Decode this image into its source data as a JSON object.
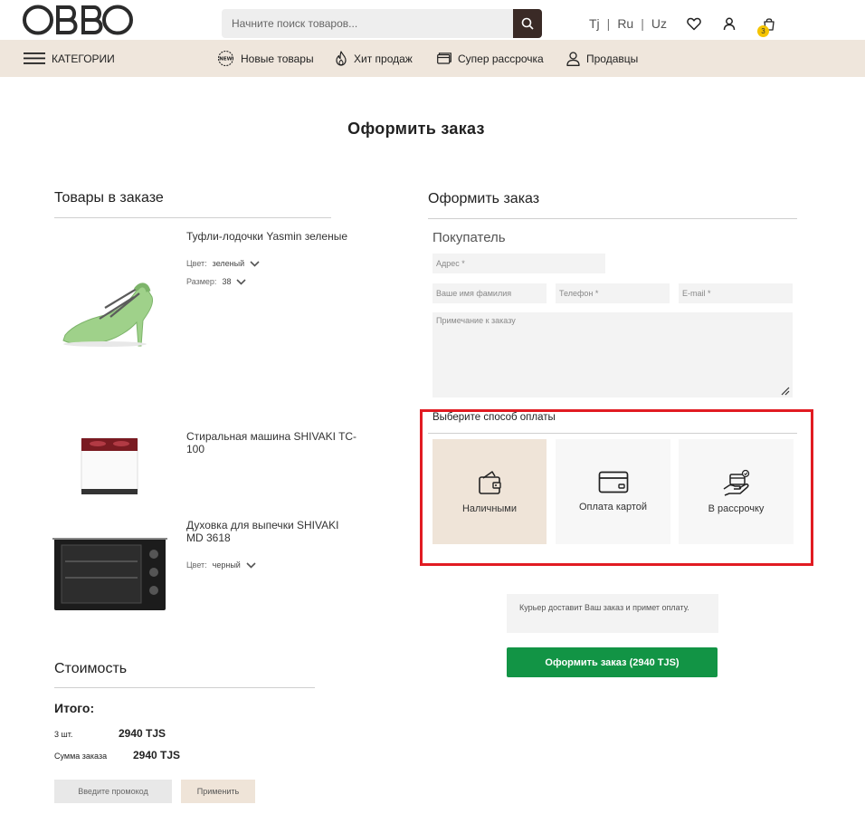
{
  "header": {
    "logo_text": "OBBO",
    "search_placeholder": "Начните поиск товаров...",
    "languages": [
      "Tj",
      "Ru",
      "Uz"
    ],
    "language_separator": "|",
    "cart_count": "3",
    "icons": [
      "search-icon",
      "heart-icon",
      "user-icon",
      "cart-icon"
    ]
  },
  "nav": {
    "categories": "КАТЕГОРИИ",
    "new_items": "Новые товары",
    "bestsellers": "Хит продаж",
    "installment": "Супер рассрочка",
    "sellers": "Продавцы"
  },
  "page_title": "Оформить заказ",
  "order_items": {
    "title": "Товары в заказе",
    "items": [
      {
        "name": "Туфли-лодочки Yasmin зеленые",
        "color_label": "Цвет:",
        "color_value": "зеленый",
        "size_label": "Размер:",
        "size_value": "38"
      },
      {
        "name": "Стиральная машина SHIVAKI TC-100"
      },
      {
        "name": "Духовка для выпечки SHIVAKI MD 3618",
        "color_label": "Цвет:",
        "color_value": "черный"
      }
    ]
  },
  "checkout": {
    "title": "Оформить заказ",
    "buyer_title": "Покупатель",
    "address_placeholder": "Адрес *",
    "name_placeholder": "Ваше имя фамилия",
    "phone_placeholder": "Телефон *",
    "email_placeholder": "E-mail *",
    "note_placeholder": "Примечание к заказу",
    "payment_title": "Выберите способ оплаты",
    "payment_methods": [
      {
        "label": "Наличными",
        "icon": "wallet-icon",
        "selected": true
      },
      {
        "label": "Оплата картой",
        "icon": "credit-card-icon",
        "selected": false
      },
      {
        "label": "В рассрочку",
        "icon": "installment-icon",
        "selected": false
      }
    ],
    "courier_info": "Курьер доставит Ваш заказ и примет оплату.",
    "submit_label": "Оформить заказ (2940 TJS)"
  },
  "cost": {
    "title": "Стоимость",
    "total_label": "Итого:",
    "qty_label": "3 шт.",
    "qty_value": "2940 TJS",
    "sum_label": "Сумма заказа",
    "sum_value": "2940 TJS",
    "promo_placeholder": "Введите промокод",
    "apply_label": "Применить"
  },
  "colors": {
    "accent_beige": "#efe6dc",
    "button_green": "#129445",
    "highlight_red": "#e11b22",
    "badge_yellow": "#f5c400"
  }
}
